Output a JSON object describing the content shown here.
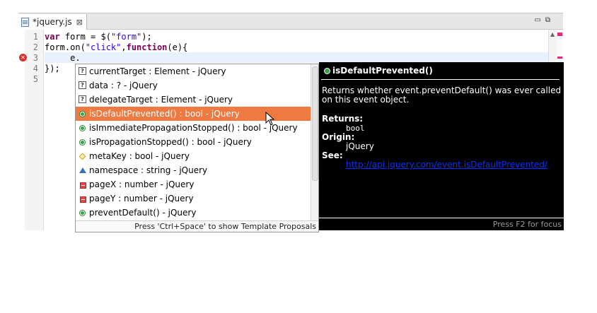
{
  "tab": {
    "title": "*jquery.js",
    "close_glyph": "⊠"
  },
  "window_buttons": {
    "minimize": "▭",
    "maximize": "⧉"
  },
  "editor": {
    "line_numbers": [
      "1",
      "2",
      "3",
      "4",
      "5"
    ],
    "lines": [
      [
        {
          "t": "var",
          "c": "kw"
        },
        {
          "t": " form = $(",
          "c": ""
        },
        {
          "t": "\"form\"",
          "c": "str"
        },
        {
          "t": ");",
          "c": ""
        }
      ],
      [
        {
          "t": "form.on(",
          "c": ""
        },
        {
          "t": "\"click\"",
          "c": "str"
        },
        {
          "t": ",",
          "c": ""
        },
        {
          "t": "function",
          "c": "kw"
        },
        {
          "t": "(e){",
          "c": ""
        }
      ],
      [
        {
          "t": "     e.",
          "c": ""
        }
      ],
      [
        {
          "t": "});",
          "c": ""
        }
      ],
      [
        {
          "t": "",
          "c": ""
        }
      ]
    ],
    "error_marker": "✕"
  },
  "proposals": {
    "items": [
      {
        "icon": "help-icon",
        "kind": "q",
        "label": "currentTarget : Element - jQuery"
      },
      {
        "icon": "help-icon",
        "kind": "q",
        "label": "data : ? - jQuery"
      },
      {
        "icon": "help-icon",
        "kind": "q",
        "label": "delegateTarget : Element - jQuery"
      },
      {
        "icon": "public-method-icon",
        "kind": "green",
        "label": "isDefaultPrevented() : bool - jQuery",
        "selected": true
      },
      {
        "icon": "public-method-icon",
        "kind": "green",
        "label": "isImmediatePropagationStopped() : bool - jQuery"
      },
      {
        "icon": "public-method-icon",
        "kind": "green",
        "label": "isPropagationStopped() : bool - jQuery"
      },
      {
        "icon": "protected-field-icon",
        "kind": "diamond",
        "label": "metaKey : bool - jQuery"
      },
      {
        "icon": "package-field-icon",
        "kind": "triangle",
        "label": "namespace : string - jQuery"
      },
      {
        "icon": "private-field-icon",
        "kind": "red",
        "label": "pageX : number - jQuery"
      },
      {
        "icon": "private-field-icon",
        "kind": "red",
        "label": "pageY : number - jQuery"
      },
      {
        "icon": "public-method-icon",
        "kind": "green",
        "label": "preventDefault() - jQuery"
      }
    ],
    "status": "Press 'Ctrl+Space' to show Template Proposals"
  },
  "info": {
    "title": "isDefaultPrevented()",
    "description": "Returns whether event.preventDefault() was ever called on this event object.",
    "returns_label": "Returns:",
    "returns_value": "bool",
    "origin_label": "Origin:",
    "origin_value": "jQuery",
    "see_label": "See:",
    "see_link": "http://api.jquery.com/event.isDefaultPrevented/",
    "footer": "Press F2 for focus"
  }
}
